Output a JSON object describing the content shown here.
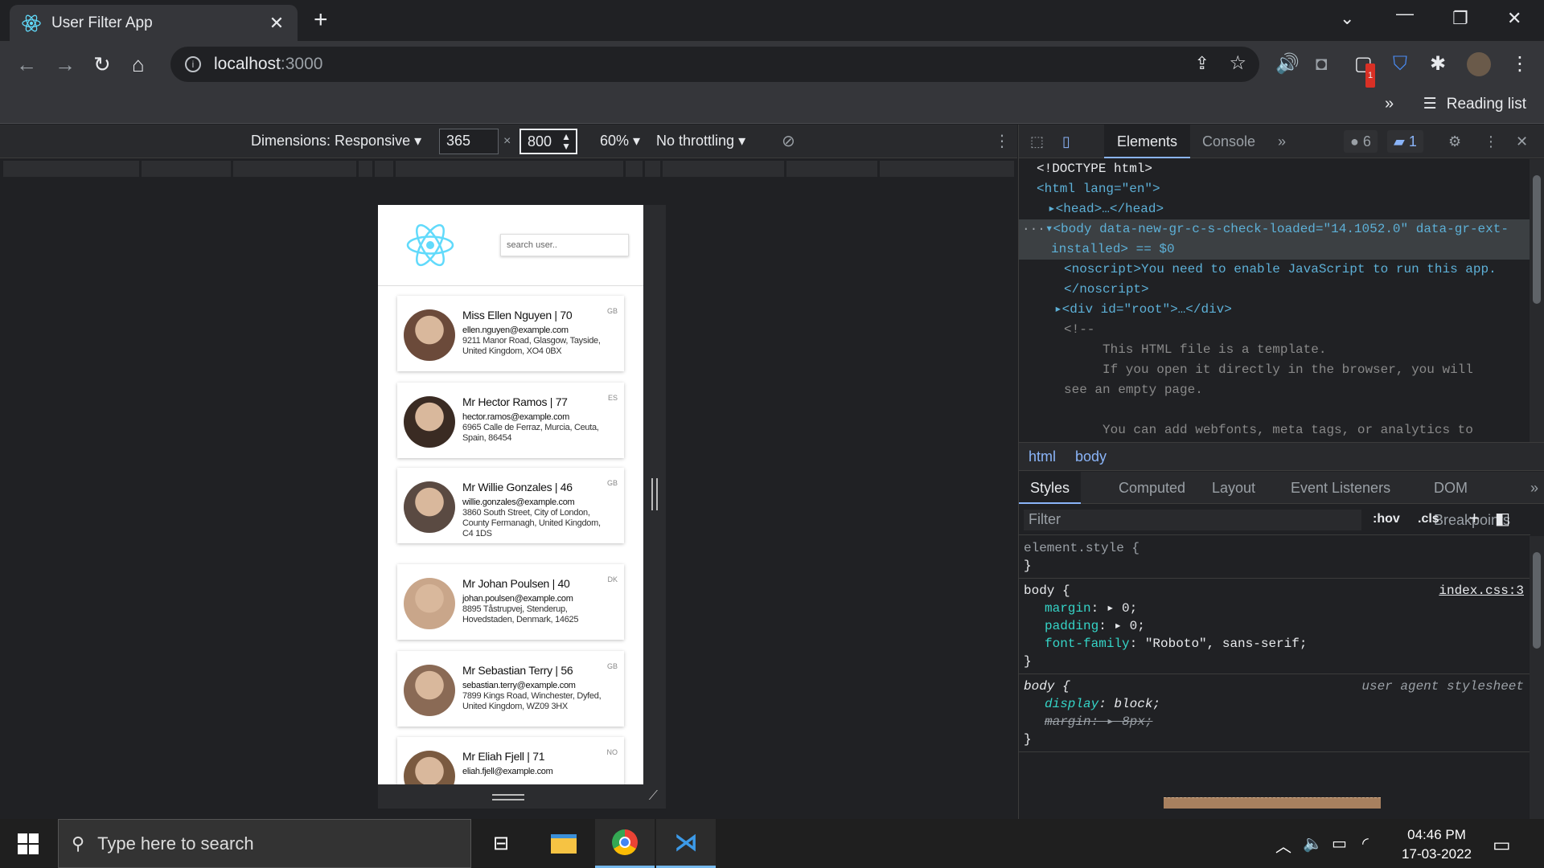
{
  "browser": {
    "tab_title": "User Filter App",
    "url_host": "localhost",
    "url_port": ":3000",
    "reading_list_label": "Reading list",
    "extension_badge": "1"
  },
  "device_toolbar": {
    "dimensions_label": "Dimensions: Responsive",
    "width": "365",
    "height": "800",
    "times": "×",
    "zoom": "60%",
    "throttling": "No throttling"
  },
  "app": {
    "search_placeholder": "search user..",
    "users": [
      {
        "name": "Miss Ellen Nguyen | 70",
        "email": "ellen.nguyen@example.com",
        "address": "9211 Manor Road, Glasgow, Tayside, United Kingdom, XO4 0BX",
        "country": "GB",
        "avatar_color": "#6b4a3a"
      },
      {
        "name": "Mr Hector Ramos | 77",
        "email": "hector.ramos@example.com",
        "address": "6965 Calle de Ferraz, Murcia, Ceuta, Spain, 86454",
        "country": "ES",
        "avatar_color": "#3a2b23"
      },
      {
        "name": "Mr Willie Gonzales | 46",
        "email": "willie.gonzales@example.com",
        "address": "3860 South Street, City of London, County Fermanagh, United Kingdom, C4 1DS",
        "country": "GB",
        "avatar_color": "#5a4a42"
      },
      {
        "name": "Mr Johan Poulsen | 40",
        "email": "johan.poulsen@example.com",
        "address": "8895 Tåstrupvej, Stenderup, Hovedstaden, Denmark, 14625",
        "country": "DK",
        "avatar_color": "#c9a68a"
      },
      {
        "name": "Mr Sebastian Terry | 56",
        "email": "sebastian.terry@example.com",
        "address": "7899 Kings Road, Winchester, Dyfed, United Kingdom, WZ09 3HX",
        "country": "GB",
        "avatar_color": "#8a6a55"
      },
      {
        "name": "Mr Eliah Fjell | 71",
        "email": "eliah.fjell@example.com",
        "address": "",
        "country": "NO",
        "avatar_color": "#7a5a40"
      }
    ]
  },
  "devtools": {
    "tabs": [
      "Elements",
      "Console"
    ],
    "errors_count": "6",
    "messages_count": "1",
    "dom_lines": {
      "doctype": "<!DOCTYPE html>",
      "html_open": "<html lang=\"en\">",
      "head": "<head>…</head>",
      "body_open": "<body data-new-gr-c-s-check-loaded=\"14.1052.0\" data-gr-ext-",
      "body_cont": "installed> == $0",
      "noscript": "<noscript>You need to enable JavaScript to run this app.",
      "noscript_close": "</noscript>",
      "root": "<div id=\"root\">…</div>",
      "comment_open": "<!--",
      "c1": "This HTML file is a template.",
      "c2": "If you open it directly in the browser, you will",
      "c3": "see an empty page.",
      "c4": "You can add webfonts, meta tags, or analytics to"
    },
    "breadcrumbs": [
      "html",
      "body"
    ],
    "style_tabs": [
      "Styles",
      "Computed",
      "Layout",
      "Event Listeners",
      "DOM Breakpoints"
    ],
    "filter_placeholder": "Filter",
    "hov": ":hov",
    "cls": ".cls",
    "rules": {
      "element_style": "element.style {",
      "close": "}",
      "body_sel": "body {",
      "source": "index.css:3",
      "margin": "margin",
      "margin_val": "0;",
      "padding": "padding",
      "padding_val": "0;",
      "font_family": "font-family",
      "font_family_val": "\"Roboto\", sans-serif;",
      "ua_label": "user agent stylesheet",
      "display": "display",
      "display_val": "block;",
      "ua_margin": "margin",
      "ua_margin_val": "8px;"
    }
  },
  "taskbar": {
    "search_placeholder": "Type here to search",
    "time": "04:46 PM",
    "date": "17-03-2022"
  }
}
